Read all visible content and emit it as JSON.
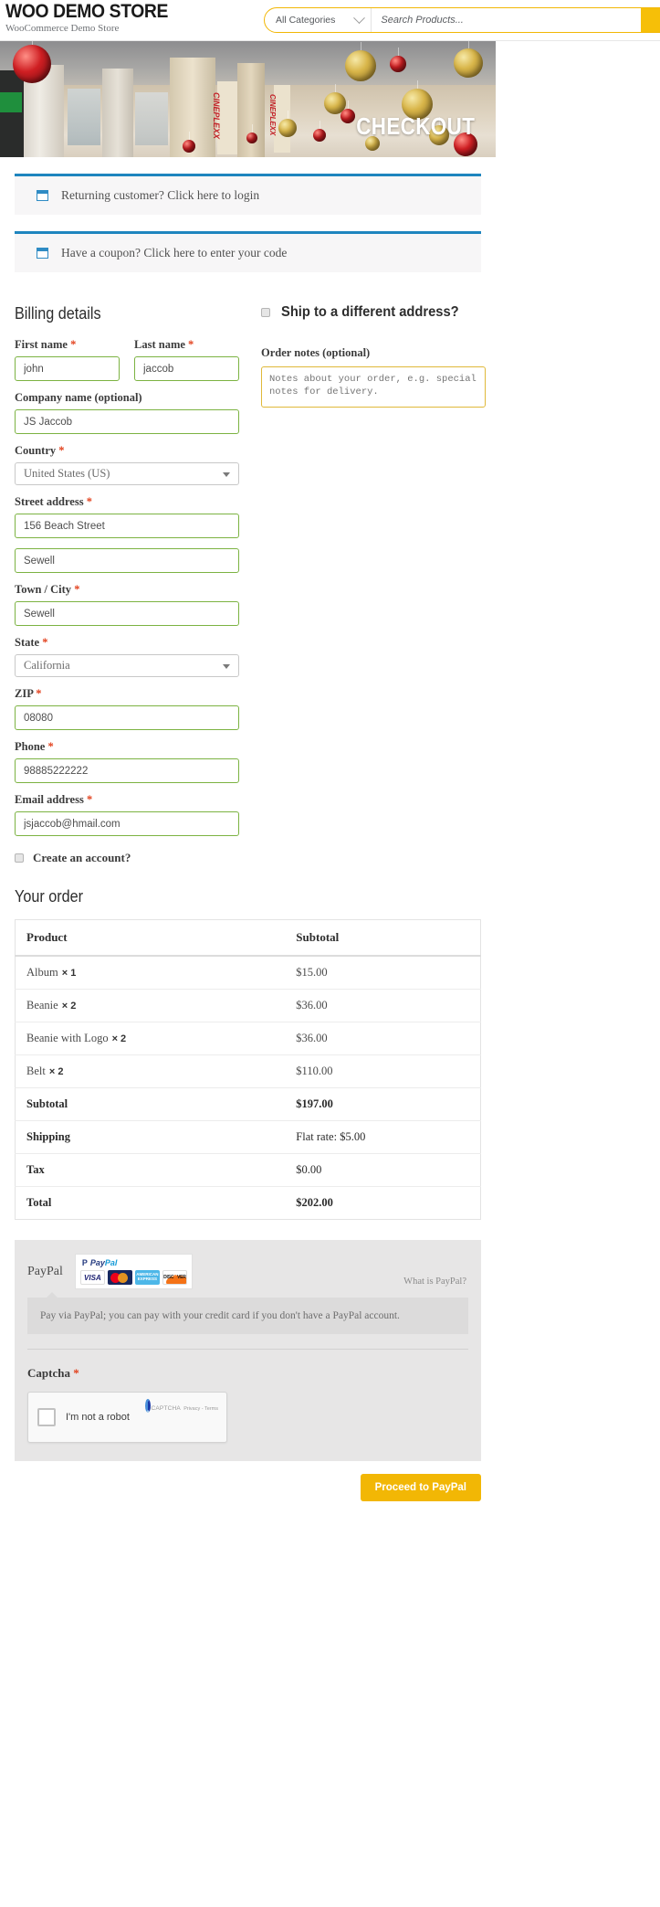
{
  "header": {
    "brand_title": "WOO DEMO STORE",
    "brand_subtitle": "WooCommerce Demo Store",
    "category_label": "All Categories",
    "search_placeholder": "Search Products...",
    "search_value": "",
    "accent_color": "#f2b705"
  },
  "hero": {
    "title": "CHECKOUT"
  },
  "notices": {
    "login": "Returning customer? Click here to login",
    "coupon": "Have a coupon? Click here to enter your code",
    "accent_color": "#1e85be"
  },
  "billing": {
    "heading": "Billing details",
    "required_mark": "*",
    "fields": {
      "first_name": {
        "label": "First name",
        "value": "john"
      },
      "last_name": {
        "label": "Last name",
        "value": "jaccob"
      },
      "company": {
        "label": "Company name (optional)",
        "value": "JS Jaccob"
      },
      "country": {
        "label": "Country",
        "value": "United States (US)"
      },
      "street_address": {
        "label": "Street address",
        "value": "156 Beach Street"
      },
      "street_address_2": {
        "label": "",
        "value": "Sewell"
      },
      "city": {
        "label": "Town / City",
        "value": "Sewell"
      },
      "state": {
        "label": "State",
        "value": "California"
      },
      "zip": {
        "label": "ZIP",
        "value": "08080"
      },
      "phone": {
        "label": "Phone",
        "value": "98885222222"
      },
      "email": {
        "label": "Email address",
        "value": "jsjaccob@hmail.com"
      }
    },
    "create_account_label": "Create an account?"
  },
  "shipping": {
    "ship_different_label": "Ship to a different address?",
    "order_notes_label": "Order notes (optional)",
    "order_notes_placeholder": "Notes about your order, e.g. special notes for delivery.",
    "order_notes_value": ""
  },
  "order": {
    "heading": "Your order",
    "columns": [
      "Product",
      "Subtotal"
    ],
    "items": [
      {
        "name": "Album",
        "qty": "× 1",
        "subtotal": "$15.00"
      },
      {
        "name": "Beanie",
        "qty": "× 2",
        "subtotal": "$36.00"
      },
      {
        "name": "Beanie with Logo",
        "qty": "× 2",
        "subtotal": "$36.00"
      },
      {
        "name": "Belt",
        "qty": "× 2",
        "subtotal": "$110.00"
      }
    ],
    "totals": [
      {
        "label": "Subtotal",
        "value": "$197.00"
      },
      {
        "label": "Shipping",
        "value": "Flat rate: $5.00"
      },
      {
        "label": "Tax",
        "value": "$0.00"
      },
      {
        "label": "Total",
        "value": "$202.00"
      }
    ]
  },
  "payment": {
    "method_label": "PayPal",
    "what_is_paypal": "What is PayPal?",
    "description": "Pay via PayPal; you can pay with your credit card if you don't have a PayPal account.",
    "cards": [
      "VISA",
      "MasterCard",
      "AMERICAN EXPRESS",
      "DISCOVER"
    ],
    "paypal_brand": "PayPal",
    "captcha_label": "Captcha",
    "captcha_text": "I'm not a robot",
    "captcha_brand": "reCAPTCHA",
    "captcha_terms": "Privacy - Terms",
    "submit_label": "Proceed to PayPal"
  }
}
